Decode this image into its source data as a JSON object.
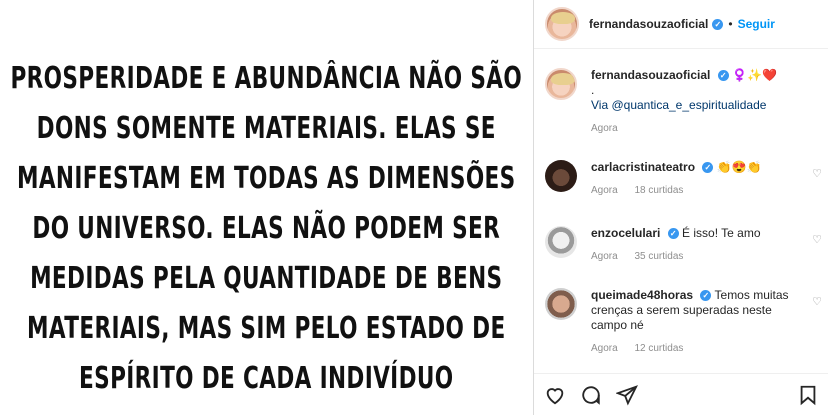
{
  "post": {
    "quote_lines": [
      "PROSPERIDADE E ABUNDÂNCIA NÃO SÃO",
      "DONS SOMENTE MATERIAIS. ELAS SE",
      "MANIFESTAM EM TODAS AS DIMENSÕES",
      "DO UNIVERSO. ELAS NÃO PODEM SER",
      "MEDIDAS PELA QUANTIDADE DE BENS",
      "MATERIAIS, MAS SIM PELO ESTADO DE",
      "ESPÍRITO DE CADA INDIVÍDUO"
    ]
  },
  "header": {
    "username": "fernandasouzaoficial",
    "separator": "•",
    "follow_label": "Seguir"
  },
  "caption": {
    "username": "fernandasouzaoficial",
    "emoji": "♀️✨❤️",
    "line2": ".",
    "line3": "Via @quantica_e_espiritualidade",
    "time": "Agora"
  },
  "comments": [
    {
      "username": "carlacristinateatro",
      "text": "👏😍👏",
      "time": "Agora",
      "likes": "18 curtidas"
    },
    {
      "username": "enzocelulari",
      "text": "É isso! Te amo",
      "time": "Agora",
      "likes": "35 curtidas"
    },
    {
      "username": "queimade48horas",
      "text": "Temos muitas crenças a serem superadas neste campo né",
      "time": "Agora",
      "likes": "12 curtidas"
    }
  ],
  "icons": {
    "verified": "verified-badge-icon",
    "like": "heart-icon",
    "comment": "comment-icon",
    "share": "paper-plane-icon",
    "save": "bookmark-icon"
  },
  "colors": {
    "accent": "#0095f6",
    "verified": "#3897f0",
    "meta": "#8e8e8e"
  }
}
